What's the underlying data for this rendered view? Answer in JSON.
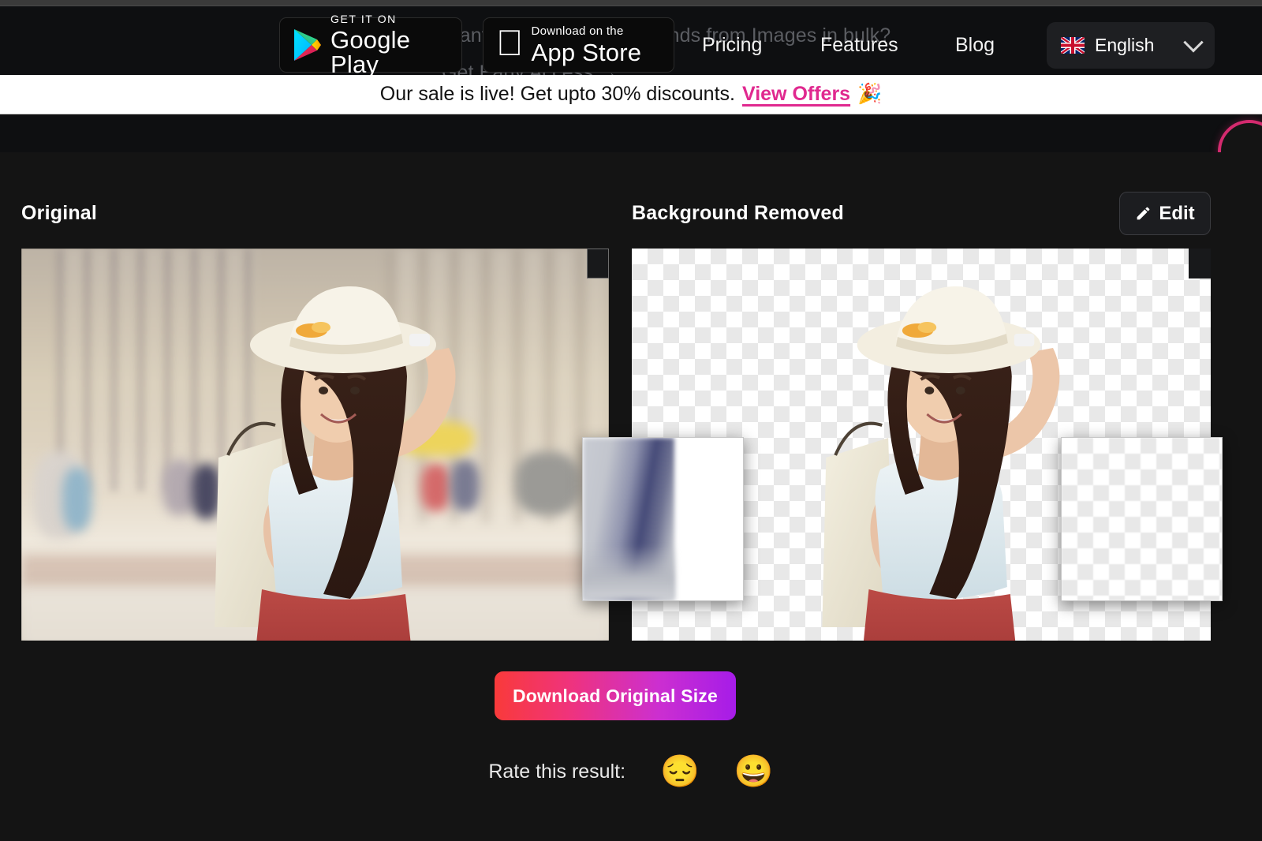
{
  "header": {
    "ghost_promo_line1": "Want to remove backgrounds from Images in bulk?",
    "ghost_promo_line2": "Get Early Access  →",
    "badges": [
      {
        "icon": "google-play-icon",
        "small": "GET IT ON",
        "big": "Google Play"
      },
      {
        "icon": "apple-icon",
        "small": "Download on the",
        "big": "App Store"
      }
    ],
    "nav": [
      {
        "id": "pricing",
        "label": "Pricing"
      },
      {
        "id": "features",
        "label": "Features"
      },
      {
        "id": "blog",
        "label": "Blog"
      }
    ],
    "language": {
      "flag": "uk-flag-icon",
      "label": "English",
      "chevron": "chevron-down-icon"
    }
  },
  "sale_banner": {
    "text": "Our sale is live! Get upto 30% discounts.",
    "link_label": "View Offers",
    "emoji": "🎉",
    "link_color": "#e0298f",
    "background": "#ffffff"
  },
  "result": {
    "original_label": "Original",
    "removed_label": "Background Removed",
    "edit_button": {
      "icon": "pencil-icon",
      "label": "Edit"
    },
    "download_button": {
      "label": "Download Original Size",
      "gradient_start": "#f93a3a",
      "gradient_end": "#a61ce8"
    },
    "magnifier_left": "magnifier-lens-original",
    "magnifier_right": "magnifier-lens-removed"
  },
  "rating": {
    "label": "Rate this result:",
    "options": [
      {
        "id": "sad",
        "emoji": "😔",
        "name": "pensive-face-emoji"
      },
      {
        "id": "happy",
        "emoji": "😀",
        "name": "grinning-face-emoji"
      }
    ]
  },
  "theme": {
    "page_background": "#141414",
    "header_background": "#0e0f11",
    "accent_pink": "#d42a6e"
  }
}
